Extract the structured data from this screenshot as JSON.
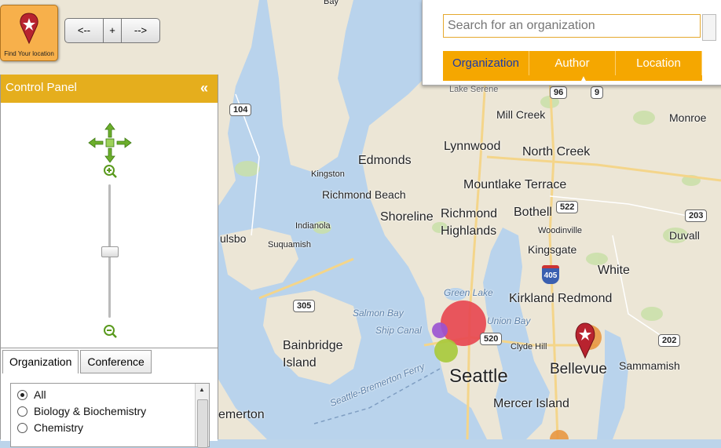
{
  "map": {
    "places": {
      "bay": "Bay",
      "lake_serene": "Lake Serene",
      "mill_creek": "Mill Creek",
      "monroe": "Monroe",
      "lynnwood": "Lynnwood",
      "north_creek": "North Creek",
      "edmonds": "Edmonds",
      "kingston": "Kingston",
      "mountlake_terrace": "Mountlake Terrace",
      "richmond_beach": "Richmond Beach",
      "shoreline": "Shoreline",
      "richmond_highlands": "Richmond\nHighlands",
      "bothell": "Bothell",
      "woodinville": "Woodinville",
      "duvall": "Duvall",
      "indianola": "Indianola",
      "kingsgate": "Kingsgate",
      "ulsbo": "ulsbo",
      "suquamish": "Suquamish",
      "white": "White",
      "green_lake": "Green Lake",
      "kirkland": "Kirkland",
      "redmond": "Redmond",
      "salmon_bay": "Salmon Bay",
      "ship_canal": "Ship Canal",
      "union_bay": "Union Bay",
      "bainbridge_island": "Bainbridge\nIsland",
      "clyde_hill": "Clyde Hill",
      "bellevue": "Bellevue",
      "sammamish": "Sammamish",
      "seattle": "Seattle",
      "bremerton_ferry": "Seattle-Bremerton Ferry",
      "emerton": "emerton",
      "mercer_island": "Mercer Island"
    },
    "shields": {
      "s104": "104",
      "s96": "96",
      "s9": "9",
      "s522": "522",
      "s203": "203",
      "s405": "405",
      "s305": "305",
      "s520": "520",
      "s202": "202"
    }
  },
  "find_location": {
    "label": "Find Your location"
  },
  "nav": {
    "back": "<--",
    "add": "+",
    "forward": "-->"
  },
  "search": {
    "placeholder": "Search for an organization",
    "tabs": [
      "Organization",
      "Author",
      "Location"
    ],
    "active_tab": "Organization"
  },
  "control_panel": {
    "title": "Control Panel",
    "collapse": "«",
    "zoom_level": 0.5,
    "lower_tabs": [
      "Organization",
      "Conference"
    ],
    "options": [
      {
        "label": "All",
        "selected": true
      },
      {
        "label": "Biology & Biochemistry",
        "selected": false
      },
      {
        "label": "Chemistry",
        "selected": false
      }
    ]
  },
  "colors": {
    "accent_orange": "#f5a700",
    "panel_header": "#e5ae1d",
    "active_tab_text": "#1a3aa8",
    "cluster_red": "#e8454f",
    "cluster_purple": "#9a52d1",
    "cluster_green": "#a7c93a",
    "cluster_orange": "#e8923a"
  }
}
